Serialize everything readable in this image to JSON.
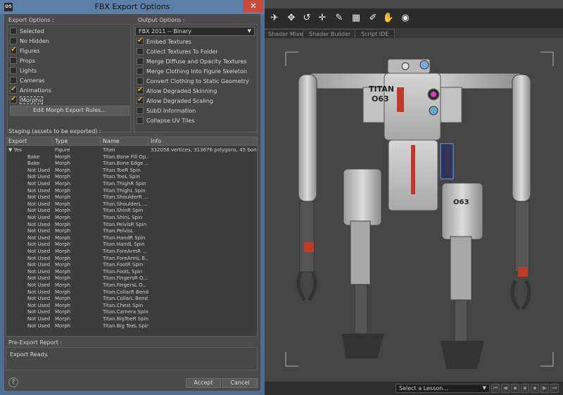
{
  "dialog": {
    "title": "FBX Export Options",
    "app_icon": "DS",
    "close": "✕"
  },
  "export_options": {
    "label": "Export Options :",
    "items": [
      {
        "label": "Selected",
        "checked": false
      },
      {
        "label": "No Hidden",
        "checked": false
      },
      {
        "label": "Figures",
        "checked": true
      },
      {
        "label": "Props",
        "checked": false
      },
      {
        "label": "Lights",
        "checked": false
      },
      {
        "label": "Cameras",
        "checked": false
      },
      {
        "label": "Animations",
        "checked": true
      },
      {
        "label": "Morphs",
        "checked": true
      }
    ],
    "edit_morph_button": "Edit Morph Export Rules..."
  },
  "output_options": {
    "label": "Output Options :",
    "format": "FBX 2011 -- Binary",
    "items": [
      {
        "label": "Embed Textures",
        "checked": true
      },
      {
        "label": "Collect Textures To Folder",
        "checked": false
      },
      {
        "label": "Merge Diffuse and Opacity Textures",
        "checked": false
      },
      {
        "label": "Merge Clothing Into Figure Skeleton",
        "checked": false
      },
      {
        "label": "Convert Clothing to Static Geometry",
        "checked": false
      },
      {
        "label": "Allow Degraded Skinning",
        "checked": true
      },
      {
        "label": "Allow Degraded Scaling",
        "checked": true
      },
      {
        "label": "SubD Information",
        "checked": false
      },
      {
        "label": "Collapse UV Tiles",
        "checked": false
      }
    ]
  },
  "staging": {
    "label": "Staging (assets to be exported) :",
    "columns": [
      "Export",
      "Type",
      "Name",
      "Info"
    ],
    "rows": [
      [
        "▼  Yes",
        "Figure",
        "Titan",
        "332058 vertices, 313676 polygons, 45 bon..."
      ],
      [
        "Bake",
        "Morph",
        "Titan.Bone Fill Op...",
        ""
      ],
      [
        "Bake",
        "Morph",
        "Titan.Bone Edge ...",
        ""
      ],
      [
        "Not Used",
        "Morph",
        "Titan.ToeR Spin",
        ""
      ],
      [
        "Not Used",
        "Morph",
        "Titan.ToeL Spin",
        ""
      ],
      [
        "Not Used",
        "Morph",
        "Titan.ThighR Spin",
        ""
      ],
      [
        "Not Used",
        "Morph",
        "Titan.ThighL Spin",
        ""
      ],
      [
        "Not Used",
        "Morph",
        "Titan.ShoulderR ...",
        ""
      ],
      [
        "Not Used",
        "Morph",
        "Titan.ShoulderL ...",
        ""
      ],
      [
        "Not Used",
        "Morph",
        "Titan.ShinR Spin",
        ""
      ],
      [
        "Not Used",
        "Morph",
        "Titan.ShinL Spin",
        ""
      ],
      [
        "Not Used",
        "Morph",
        "Titan.PelvisR Spin",
        ""
      ],
      [
        "Not Used",
        "Morph",
        "Titan.PelvisL",
        ""
      ],
      [
        "Not Used",
        "Morph",
        "Titan.HandR Spin",
        ""
      ],
      [
        "Not Used",
        "Morph",
        "Titan.HandL Spin",
        ""
      ],
      [
        "Not Used",
        "Morph",
        "Titan.ForeArmR ...",
        ""
      ],
      [
        "Not Used",
        "Morph",
        "Titan.ForeArmL B...",
        ""
      ],
      [
        "Not Used",
        "Morph",
        "Titan.FootR Spin",
        ""
      ],
      [
        "Not Used",
        "Morph",
        "Titan.FootL Spin",
        ""
      ],
      [
        "Not Used",
        "Morph",
        "Titan.FingersR O...",
        ""
      ],
      [
        "Not Used",
        "Morph",
        "Titan.FingersL O...",
        ""
      ],
      [
        "Not Used",
        "Morph",
        "Titan.CollarR Bend",
        ""
      ],
      [
        "Not Used",
        "Morph",
        "Titan.CollarL Bend",
        ""
      ],
      [
        "Not Used",
        "Morph",
        "Titan.Chest Spin",
        ""
      ],
      [
        "Not Used",
        "Morph",
        "Titan.Camera Spin",
        ""
      ],
      [
        "Not Used",
        "Morph",
        "Titan.BigToeR Spin",
        ""
      ],
      [
        "Not Used",
        "Morph",
        "Titan.Big ToeL Spin",
        ""
      ]
    ]
  },
  "report": {
    "label": "Pre-Export Report :",
    "text": "Export Ready."
  },
  "footer": {
    "help": "?",
    "accept": "Accept",
    "cancel": "Cancel"
  },
  "viewport": {
    "tabs": [
      "Shader Mixer",
      "Shader Builder",
      "Script IDE"
    ],
    "lesson_placeholder": "Select a Lesson...",
    "robot_labels": [
      "TITAN",
      "O63",
      "O63"
    ]
  }
}
